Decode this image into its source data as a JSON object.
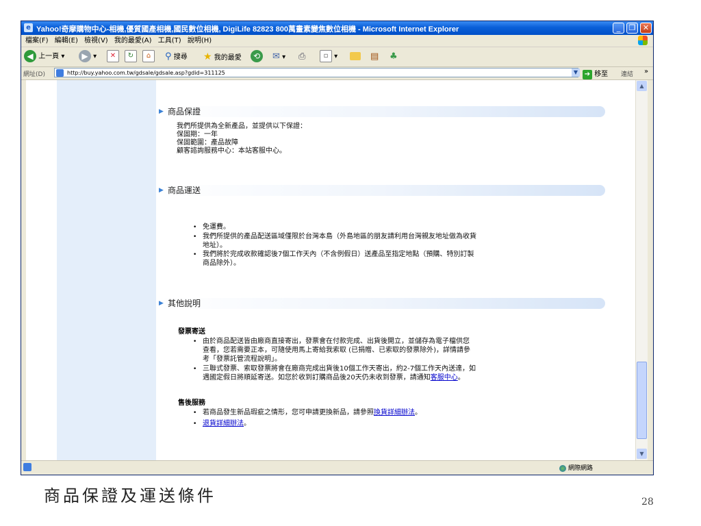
{
  "window": {
    "title": "Yahoo!奇摩購物中心-相機,優質國產相機,國民數位相機, DigiLife 82823 800萬畫素變焦數位相機 - Microsoft Internet Explorer"
  },
  "menubar": {
    "items": [
      "檔案(F)",
      "編輯(E)",
      "檢視(V)",
      "我的最愛(A)",
      "工具(T)",
      "說明(H)"
    ]
  },
  "toolbar": {
    "back_label": "上一頁",
    "search_label": "搜尋",
    "favorites_label": "我的最愛"
  },
  "address": {
    "label": "網址(D)",
    "url": "http://buy.yahoo.com.tw/gdsale/gdsale.asp?gdid=311125",
    "go_label": "移至",
    "links_label": "連結"
  },
  "sections": {
    "warranty": {
      "title": "商品保證",
      "lines": [
        "我們所提供為全新產品，並提供以下保證：",
        "保固期：一年",
        "保固範圍：產品故障",
        "顧客諮詢服務中心：本站客服中心。"
      ]
    },
    "shipping": {
      "title": "商品運送",
      "bullet1": "免運費。",
      "bullet2_line1": "我們所提供的產品配送區域僅限於台灣本島（外島地區的朋友請利用台灣親友地址做為收貨",
      "bullet2_line2": "地址）。",
      "bullet3_line1": "我們將於完成收款確認後7個工作天內（不含例假日）送產品至指定地點（預購、特別訂製",
      "bullet3_line2": "商品除外）。"
    },
    "other": {
      "title": "其他說明",
      "invoice_heading": "發票寄送",
      "inv1_line1": "由於商品配送皆由廠商直接寄出，發票會在付款完成、出貨後開立，並儲存為電子檔供您",
      "inv1_line2": "查看，您若需要正本，可隨使用馬上寄給我索取 (已捐贈、已索取的發票除外)，詳情請參",
      "inv1_line3": "考「發票託管流程說明」。",
      "inv2_line1": "三聯式發票、索取發票將會在廠商完成出貨後10個工作天寄出，約2-7個工作天內送達，如",
      "inv2_line2_prefix": "遇國定假日將順延寄送。如您於收到訂購商品後20天仍未收到發票，請通知",
      "inv2_link": "客服中心",
      "inv2_line2_suffix": "。",
      "after_heading": "售後服務",
      "after1_prefix": "若商品發生新品瑕疵之情形，您可申請更換新品，請參照",
      "after1_link": "換貨詳細辦法",
      "after1_suffix": "。",
      "after2_link": "退貨詳細辦法",
      "after2_suffix": "。"
    }
  },
  "statusbar": {
    "zone_label": "網際網路"
  },
  "slide": {
    "caption": "商品保證及運送條件",
    "page_number": "28"
  }
}
